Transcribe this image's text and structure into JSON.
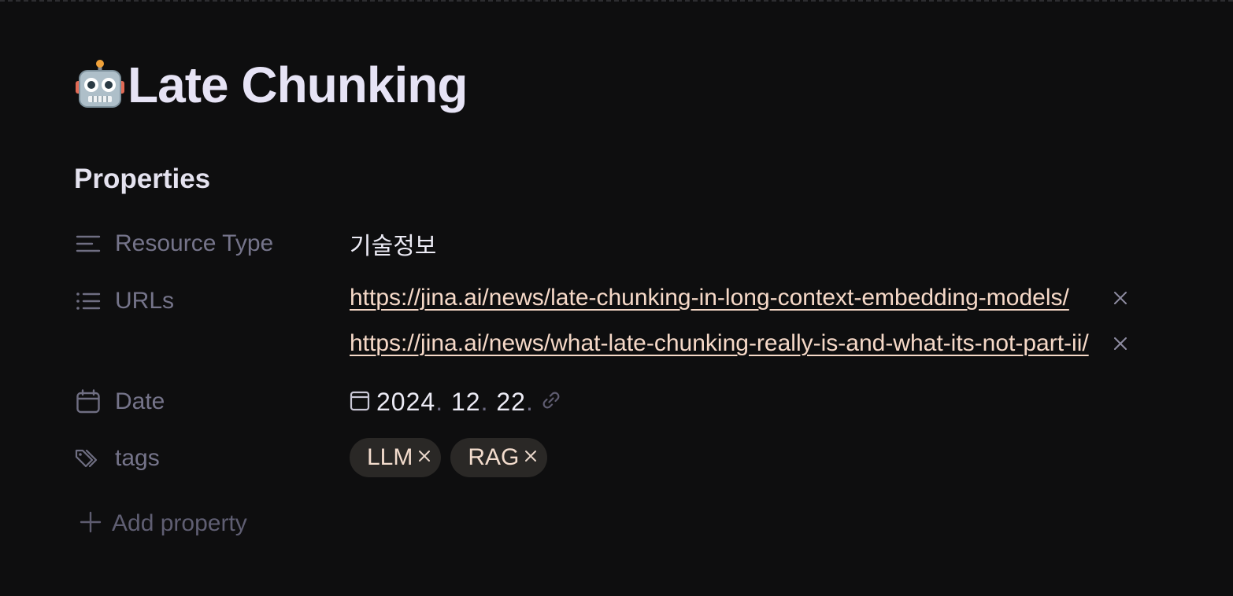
{
  "page": {
    "title": "Late Chunking",
    "title_icon": "robot-face-icon"
  },
  "properties": {
    "section_title": "Properties",
    "resource_type": {
      "label": "Resource Type",
      "icon": "text-align-icon",
      "value": "기술정보"
    },
    "urls": {
      "label": "URLs",
      "icon": "list-icon",
      "items": [
        {
          "text": "https://jina.ai/news/late-chunking-in-long-context-embedding-models/"
        },
        {
          "text": "https://jina.ai/news/what-late-chunking-really-is-and-what-its-not-part-ii/"
        }
      ]
    },
    "date": {
      "label": "Date",
      "icon": "calendar-icon",
      "year": "2024",
      "month": "12",
      "day": "22",
      "separator": "."
    },
    "tags": {
      "label": "tags",
      "icon": "tags-icon",
      "items": [
        {
          "text": "LLM"
        },
        {
          "text": "RAG"
        }
      ]
    },
    "add_property_label": "Add property"
  },
  "colors": {
    "background": "#0e0e0f",
    "link": "#f6d9c8",
    "tag_bg": "#2a2826",
    "muted": "#75748a"
  }
}
